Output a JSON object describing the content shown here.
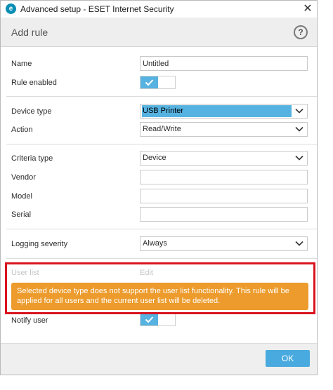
{
  "window": {
    "title": "Advanced setup - ESET Internet Security",
    "logo_glyph": "e"
  },
  "header": {
    "title": "Add rule"
  },
  "fields": {
    "name": {
      "label": "Name",
      "value": "Untitled"
    },
    "rule_enabled": {
      "label": "Rule enabled",
      "state": "on"
    },
    "device_type": {
      "label": "Device type",
      "value": "USB Printer"
    },
    "action": {
      "label": "Action",
      "value": "Read/Write"
    },
    "criteria_type": {
      "label": "Criteria type",
      "value": "Device"
    },
    "vendor": {
      "label": "Vendor",
      "value": ""
    },
    "model": {
      "label": "Model",
      "value": ""
    },
    "serial": {
      "label": "Serial",
      "value": ""
    },
    "logging_severity": {
      "label": "Logging severity",
      "value": "Always"
    },
    "user_list": {
      "label": "User list",
      "edit_label": "Edit"
    },
    "notify_user": {
      "label": "Notify user",
      "state": "on"
    }
  },
  "warning": {
    "text": "Selected device type does not support the user list functionality. This rule will be applied for all users and the current user list will be deleted."
  },
  "footer": {
    "ok_label": "OK"
  },
  "colors": {
    "accent": "#56b2e0",
    "warning": "#ec9b2c",
    "highlight_box": "#d9141f",
    "ok_button": "#49aadf"
  },
  "icons": {
    "help": "question-circle-icon",
    "close": "close-icon",
    "chevron": "chevron-down-icon",
    "check": "check-icon"
  }
}
